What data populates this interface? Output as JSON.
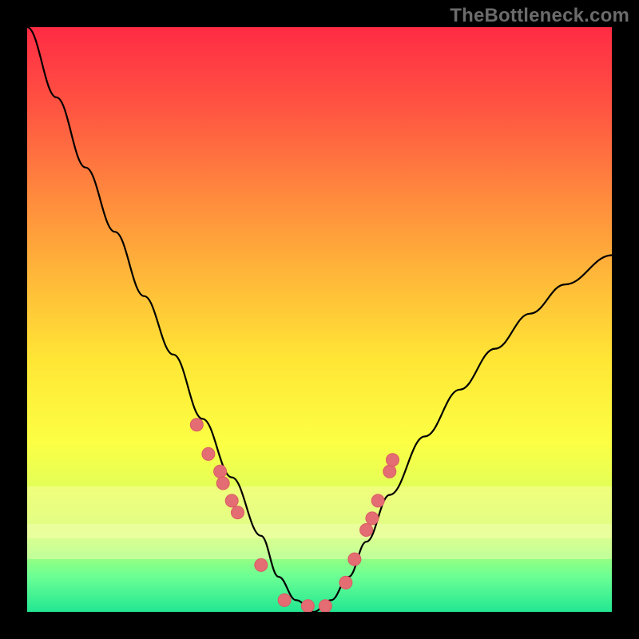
{
  "watermark": "TheBottleneck.com",
  "chart_data": {
    "type": "line",
    "title": "",
    "xlabel": "",
    "ylabel": "",
    "xlim": [
      0,
      100
    ],
    "ylim": [
      0,
      100
    ],
    "series": [
      {
        "name": "bottleneck-curve",
        "x": [
          0,
          5,
          10,
          15,
          20,
          25,
          30,
          35,
          40,
          43,
          46,
          49,
          52,
          55,
          58,
          62,
          68,
          74,
          80,
          86,
          92,
          100
        ],
        "y": [
          100,
          88,
          76,
          65,
          54,
          44,
          33,
          23,
          13,
          6,
          2,
          0,
          2,
          6,
          12,
          20,
          30,
          38,
          45,
          51,
          56,
          61
        ]
      }
    ],
    "markers": {
      "name": "highlighted-points",
      "x": [
        29,
        31,
        33,
        33.5,
        35,
        36,
        40,
        44,
        48,
        51,
        54.5,
        56,
        58,
        59,
        60,
        62,
        62.5
      ],
      "y": [
        32,
        27,
        24,
        22,
        19,
        17,
        8,
        2,
        1,
        1,
        5,
        9,
        14,
        16,
        19,
        24,
        26
      ]
    },
    "bands": [
      {
        "name": "pale-yellow-band-upper",
        "y_from": 14,
        "y_to": 21
      },
      {
        "name": "pale-yellow-band-lower",
        "y_from": 9,
        "y_to": 15
      }
    ]
  }
}
